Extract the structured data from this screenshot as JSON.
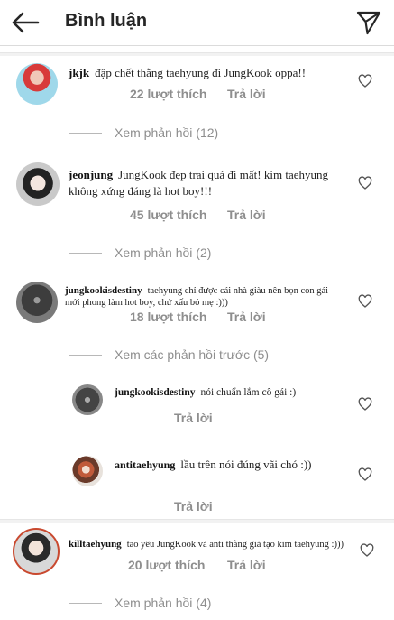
{
  "header": {
    "title": "Bình luận"
  },
  "comments": [
    {
      "username": "jkjk",
      "text": "đập chết thằng taehyung đi JungKook oppa!!",
      "likes": "22 lượt thích",
      "reply": "Trả lời",
      "view_replies": "Xem phản hồi (12)"
    },
    {
      "username": "jeonjung",
      "text_line1": "JungKook đẹp trai quá đi mất! kim taehyung",
      "text_line2": "không xứng đáng là hot boy!!!",
      "likes": "45 lượt thích",
      "reply": "Trả lời",
      "view_replies": "Xem phản hồi (2)"
    },
    {
      "username": "jungkookisdestiny",
      "text_line1": "taehyung chỉ được cái nhà giàu nên bọn con gái",
      "text_line2": "mới phong làm hot boy, chứ xấu bỏ mẹ :)))",
      "likes": "18 lượt thích",
      "reply": "Trả lời",
      "view_previous": "Xem các phản hồi trước (5)"
    },
    {
      "username": "killtaehyung",
      "text": "tao yêu JungKook và anti thằng giả tạo kim taehyung :)))",
      "likes": "20 lượt thích",
      "reply": "Trả lời",
      "view_replies": "Xem phản hồi (4)"
    }
  ],
  "replies": [
    {
      "username": "jungkookisdestiny",
      "text": "nói chuẩn lắm cô gái :)",
      "reply": "Trả lời"
    },
    {
      "username": "antitaehyung",
      "text": "lầu trên nói đúng vãi chó :))",
      "reply": "Trả lời"
    }
  ],
  "colors": {
    "meta_gray": "#8e8e8e",
    "text": "#262626",
    "divider": "#dbdbdb"
  },
  "icons": [
    "back-arrow-icon",
    "send-icon",
    "heart-icon"
  ]
}
